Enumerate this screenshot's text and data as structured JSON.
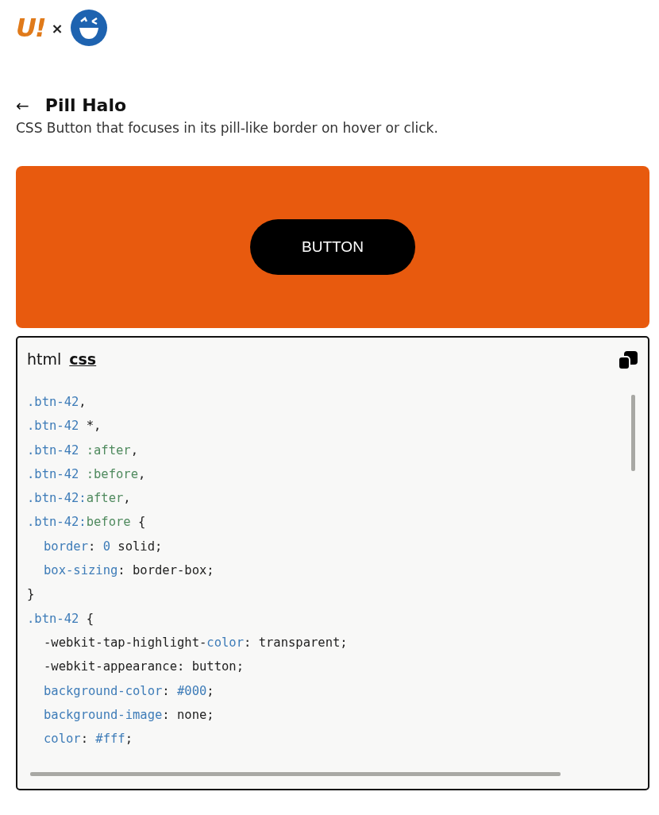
{
  "header": {
    "logo_text": "U!",
    "separator": "×"
  },
  "title": {
    "back": "←",
    "text": "Pill Halo"
  },
  "description": "CSS Button that focuses in its pill-like border on hover or click.",
  "preview": {
    "button": "BUTTON"
  },
  "code_panel": {
    "tabs": [
      {
        "label": "html",
        "selected": false
      },
      {
        "label": "css",
        "selected": true
      }
    ],
    "lines": [
      {
        "indented": false,
        "tokens": [
          {
            "kind": "sel",
            "text": ".btn-42"
          },
          {
            "kind": "text",
            "text": ","
          }
        ]
      },
      {
        "indented": false,
        "tokens": [
          {
            "kind": "sel",
            "text": ".btn-42"
          },
          {
            "kind": "text",
            "text": " *,"
          }
        ]
      },
      {
        "indented": false,
        "tokens": [
          {
            "kind": "sel",
            "text": ".btn-42"
          },
          {
            "kind": "pseudo",
            "text": " :after"
          },
          {
            "kind": "text",
            "text": ","
          }
        ]
      },
      {
        "indented": false,
        "tokens": [
          {
            "kind": "sel",
            "text": ".btn-42"
          },
          {
            "kind": "pseudo",
            "text": " :before"
          },
          {
            "kind": "text",
            "text": ","
          }
        ]
      },
      {
        "indented": false,
        "tokens": [
          {
            "kind": "sel",
            "text": ".btn-42:"
          },
          {
            "kind": "pseudo",
            "text": "after"
          },
          {
            "kind": "text",
            "text": ","
          }
        ]
      },
      {
        "indented": false,
        "tokens": [
          {
            "kind": "sel",
            "text": ".btn-42:"
          },
          {
            "kind": "pseudo",
            "text": "before"
          },
          {
            "kind": "text",
            "text": " {"
          }
        ]
      },
      {
        "indented": true,
        "tokens": [
          {
            "kind": "prop",
            "text": "border"
          },
          {
            "kind": "text",
            "text": ": "
          },
          {
            "kind": "num",
            "text": "0"
          },
          {
            "kind": "text",
            "text": " solid;"
          }
        ]
      },
      {
        "indented": true,
        "tokens": [
          {
            "kind": "prop",
            "text": "box-sizing"
          },
          {
            "kind": "text",
            "text": ": border-box;"
          }
        ]
      },
      {
        "indented": false,
        "tokens": [
          {
            "kind": "text",
            "text": "}"
          }
        ]
      },
      {
        "indented": false,
        "tokens": [
          {
            "kind": "sel",
            "text": ".btn-42"
          },
          {
            "kind": "text",
            "text": " {"
          }
        ]
      },
      {
        "indented": true,
        "tokens": [
          {
            "kind": "text",
            "text": "-webkit-tap-highlight-"
          },
          {
            "kind": "prop",
            "text": "color"
          },
          {
            "kind": "text",
            "text": ": transparent;"
          }
        ]
      },
      {
        "indented": true,
        "tokens": [
          {
            "kind": "text",
            "text": "-webkit-appearance: button;"
          }
        ]
      },
      {
        "indented": true,
        "tokens": [
          {
            "kind": "prop",
            "text": "background-color"
          },
          {
            "kind": "text",
            "text": ": "
          },
          {
            "kind": "num",
            "text": "#000"
          },
          {
            "kind": "text",
            "text": ";"
          }
        ]
      },
      {
        "indented": true,
        "tokens": [
          {
            "kind": "prop",
            "text": "background-image"
          },
          {
            "kind": "text",
            "text": ": none;"
          }
        ]
      },
      {
        "indented": true,
        "tokens": [
          {
            "kind": "prop",
            "text": "color"
          },
          {
            "kind": "text",
            "text": ": "
          },
          {
            "kind": "num",
            "text": "#fff"
          },
          {
            "kind": "text",
            "text": ";"
          }
        ]
      }
    ]
  }
}
